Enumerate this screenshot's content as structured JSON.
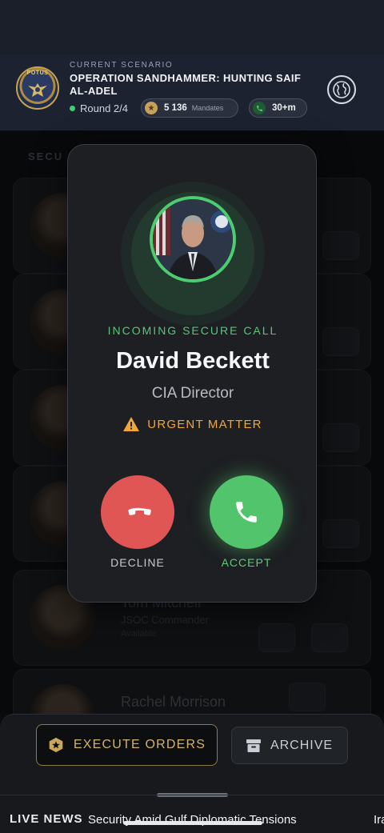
{
  "header": {
    "seal_text": "POTUS",
    "scenario_label": "CURRENT SCENARIO",
    "scenario_title": "OPERATION SANDHAMMER: HUNTING SAIF AL-ADEL",
    "round": "Round 2/4",
    "mandates_value": "5 136",
    "mandates_label": "Mandates",
    "timer": "30+m",
    "globe_icon": "globe-icon"
  },
  "background_list": {
    "section_label": "SECU",
    "contacts": [
      {
        "name": "",
        "role": "",
        "status": ""
      },
      {
        "name": "",
        "role": "",
        "status": ""
      },
      {
        "name": "",
        "role": "",
        "status": ""
      },
      {
        "name": "",
        "role": "",
        "status": ""
      },
      {
        "name": "Tom Mitchell",
        "role": "JSOC Commander",
        "status": "Available"
      },
      {
        "name": "Rachel Morrison",
        "role": "",
        "status": ""
      }
    ]
  },
  "call": {
    "label": "INCOMING SECURE CALL",
    "caller_name": "David Beckett",
    "caller_role": "CIA Director",
    "urgency": "URGENT MATTER",
    "decline_label": "DECLINE",
    "accept_label": "ACCEPT"
  },
  "bottom": {
    "execute_label": "EXECUTE ORDERS",
    "archive_label": "ARCHIVE"
  },
  "ticker": {
    "live_label": "LIVE NEWS",
    "headline": "Security Amid Gulf Diplomatic Tensions",
    "next_headline": "Ira"
  },
  "colors": {
    "accept": "#52c46b",
    "decline": "#e05654",
    "urgent": "#f0a73a",
    "gold": "#d4b26a"
  }
}
